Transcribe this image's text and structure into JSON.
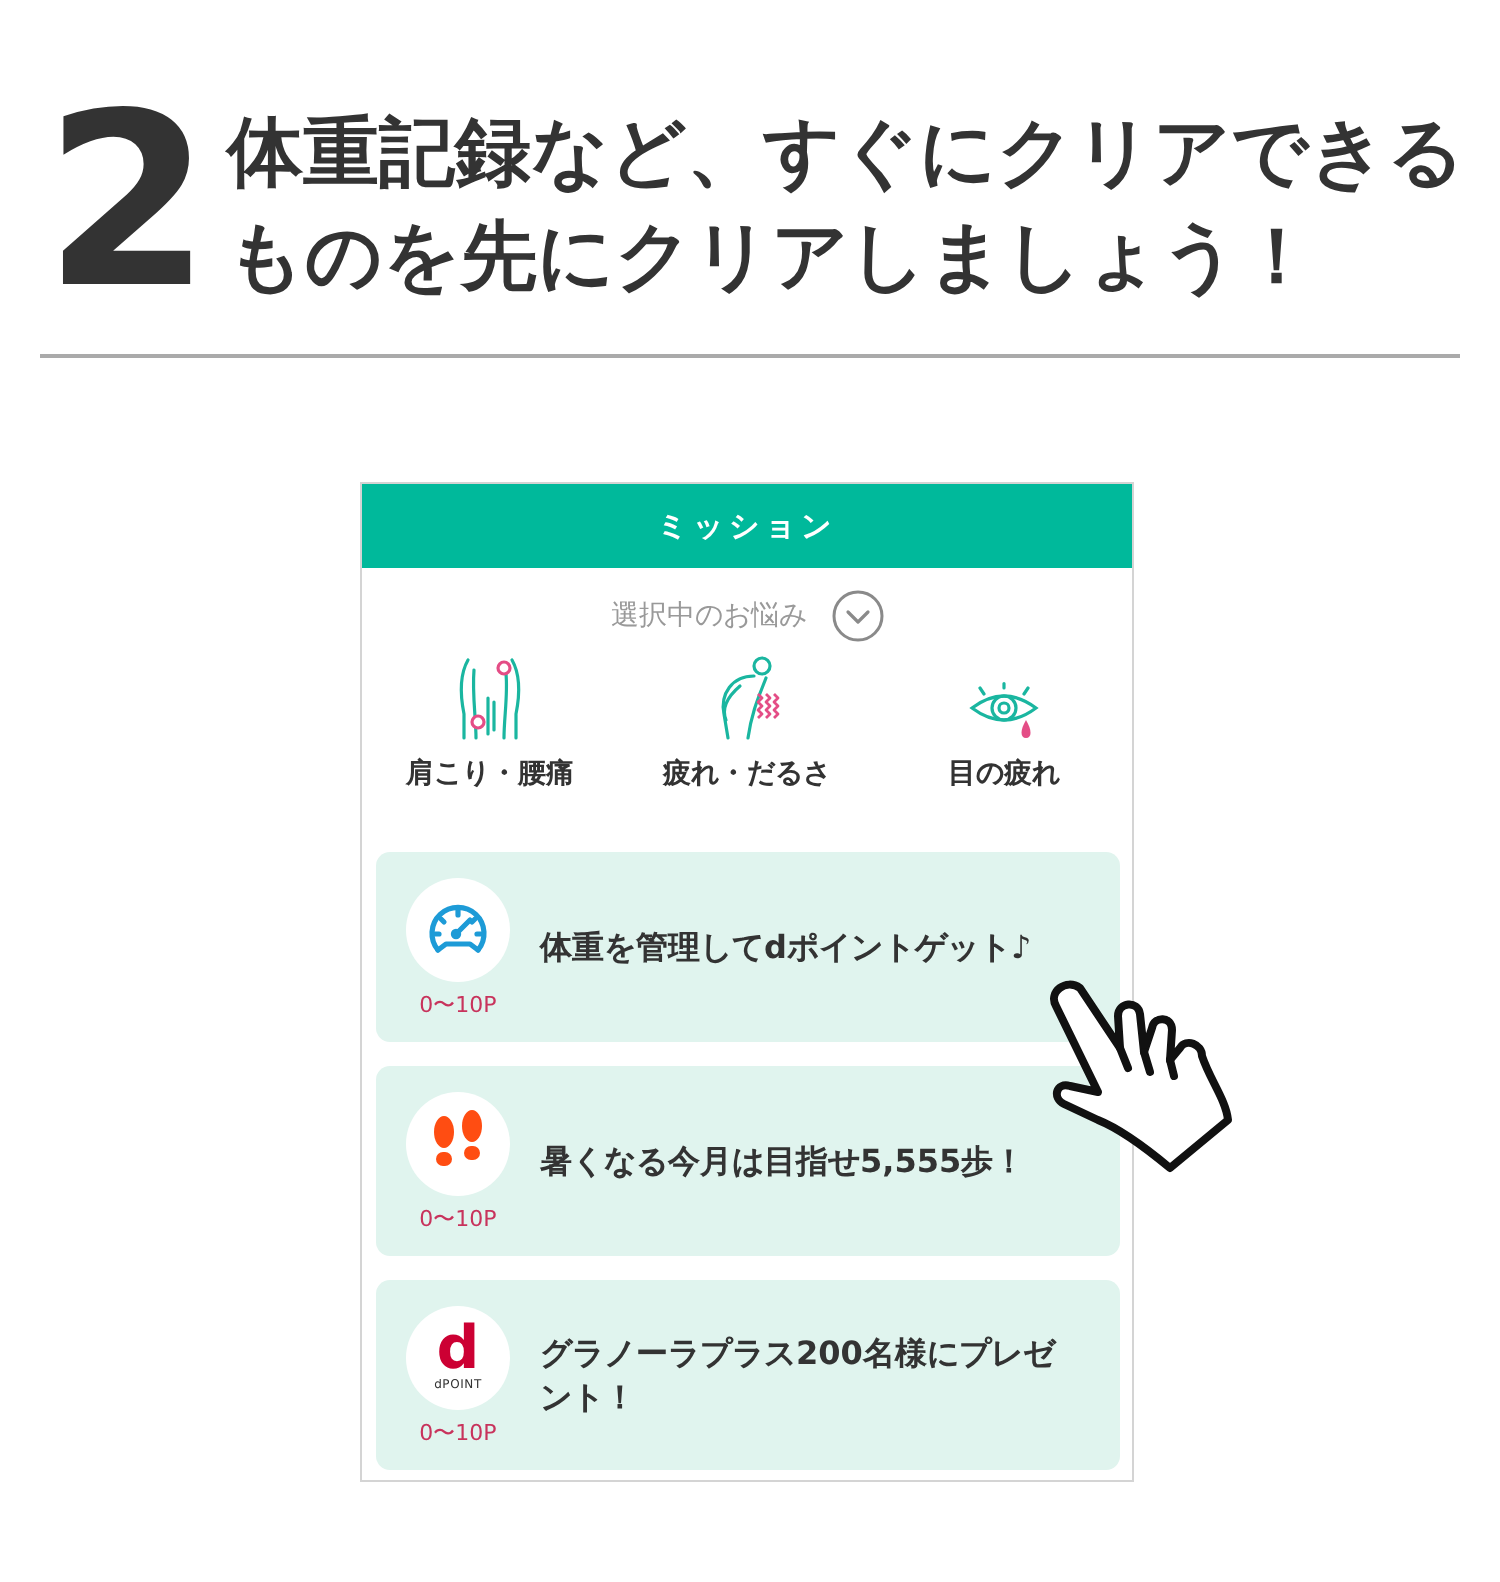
{
  "step": {
    "number": "2",
    "title_lines": [
      "体重記録など、すぐにクリアできる",
      "ものを先にクリアしましょう！"
    ]
  },
  "mission_panel": {
    "title": "ミッション",
    "concerns_label": "選択中のお悩み",
    "concerns": [
      {
        "kind": "shoulder_back",
        "label": "肩こり・腰痛"
      },
      {
        "kind": "fatigue",
        "label": "疲れ・だるさ"
      },
      {
        "kind": "eye",
        "label": "目の疲れ"
      }
    ],
    "missions": [
      {
        "kind": "gauge",
        "text": "体重を管理してdポイントゲット♪",
        "points": "0〜10P"
      },
      {
        "kind": "footprints",
        "text": "暑くなる今月は目指せ5,555歩！",
        "points": "0〜10P"
      },
      {
        "kind": "dpoint",
        "logo_mark": "d",
        "logo_caption": "dPOINT",
        "text": "グラノーラプラス200名様にプレゼント！",
        "points": "0〜10P"
      }
    ]
  }
}
